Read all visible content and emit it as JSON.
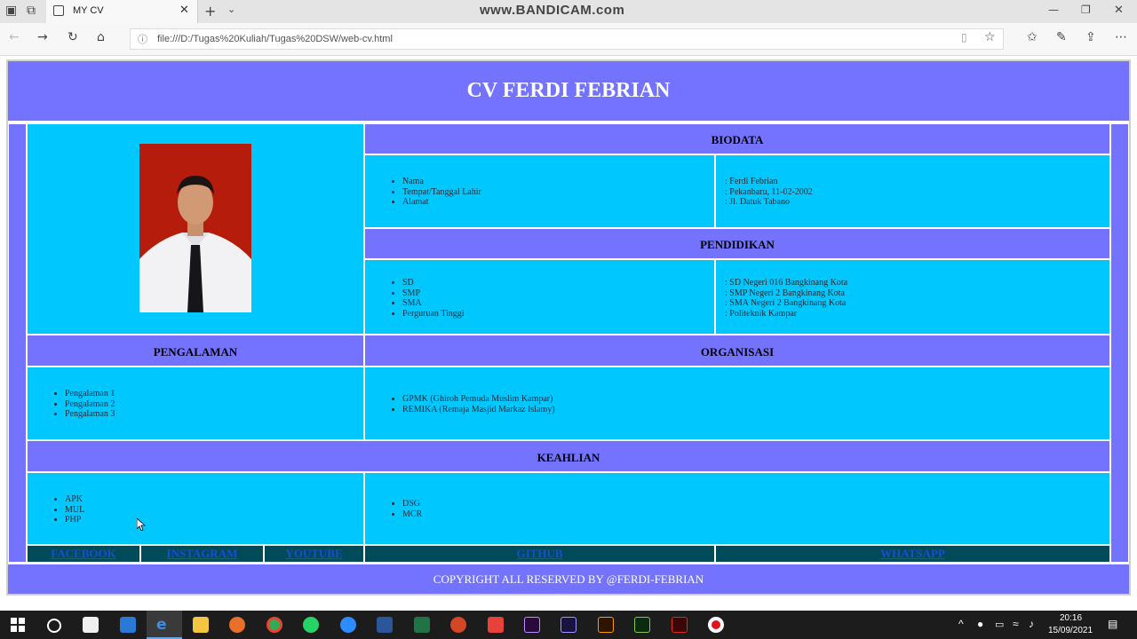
{
  "browser": {
    "tab_title": "MY CV",
    "watermark": "www.BANDICAM.com",
    "url": "file:///D:/Tugas%20Kuliah/Tugas%20DSW/web-cv.html"
  },
  "cv": {
    "title": "CV FERDI FEBRIAN",
    "biodata": {
      "heading": "BIODATA",
      "labels": [
        "Nama",
        "Tempat/Tanggal Lahir",
        "Alamat"
      ],
      "values": [
        ": Ferdi Febrian",
        ": Pekanbaru, 11-02-2002",
        ": Jl. Datuk Tabano"
      ]
    },
    "pendidikan": {
      "heading": "PENDIDIKAN",
      "labels": [
        "SD",
        "SMP",
        "SMA",
        "Perguruan Tinggi"
      ],
      "values": [
        ": SD Negeri 016 Bangkinang Kota",
        ": SMP Negeri 2 Bangkinang Kota",
        ": SMA Negeri 2 Bangkinang Kota",
        ": Politeknik Kampar"
      ]
    },
    "pengalaman": {
      "heading": "PENGALAMAN",
      "items": [
        "Pengalaman 1",
        "Pengalaman 2",
        "Pengalaman 3"
      ]
    },
    "organisasi": {
      "heading": "ORGANISASI",
      "items": [
        "GPMK (Ghiroh Pemuda Muslim Kampar)",
        "REMIKA (Remaja Masjid Markaz Islamy)"
      ]
    },
    "keahlian": {
      "heading": "KEAHLIAN",
      "left": [
        "APK",
        "MUL",
        "PHP"
      ],
      "right": [
        "DSG",
        "MCR"
      ]
    },
    "links": [
      "FACEBOOK",
      "INSTAGRAM",
      "YOUTUBE",
      "GITHUB",
      "WHATSAPP"
    ],
    "footer": "COPYRIGHT ALL RESERVED BY @FERDI-FEBRIAN"
  },
  "taskbar": {
    "time": "20:16",
    "date": "15/09/2021"
  },
  "colors": {
    "header_purple": "#7373ff",
    "cell_cyan": "#00c8ff",
    "link_bar": "#004b5a"
  }
}
